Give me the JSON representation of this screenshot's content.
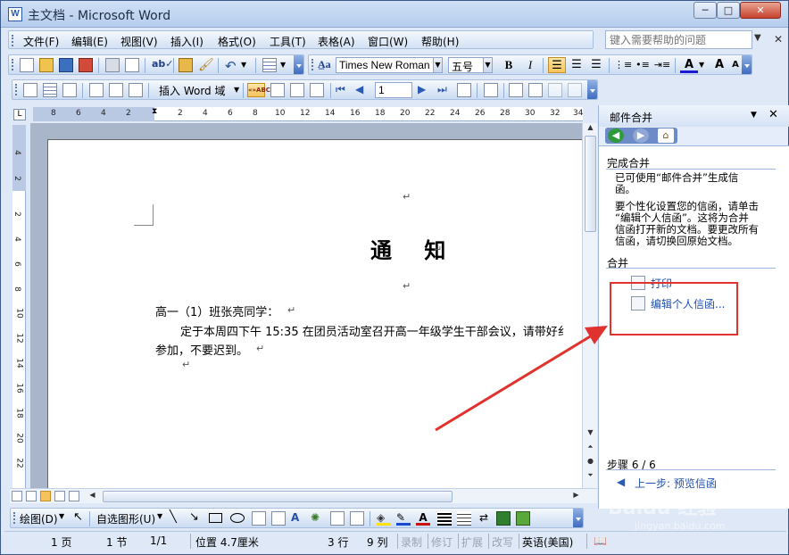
{
  "window": {
    "title": "主文档 - Microsoft Word"
  },
  "menu": {
    "items": [
      "文件(F)",
      "编辑(E)",
      "视图(V)",
      "插入(I)",
      "格式(O)",
      "工具(T)",
      "表格(A)",
      "窗口(W)",
      "帮助(H)"
    ],
    "help_placeholder": "键入需要帮助的问题"
  },
  "format_toolbar": {
    "font_name": "Times New Roman",
    "font_size": "五号",
    "bold": "B",
    "italic": "I",
    "font_color_label": "A",
    "grow_font": "A",
    "shrink_font": "A"
  },
  "mailmerge_toolbar": {
    "insert_field": "插入 Word 域",
    "record_number": "1",
    "abc_label": "«»ABC"
  },
  "ruler": {
    "h_numbers": [
      "8",
      "6",
      "4",
      "2",
      "2",
      "4",
      "6",
      "8",
      "10",
      "12",
      "14",
      "16",
      "18",
      "20",
      "22",
      "24",
      "26",
      "28",
      "30",
      "32",
      "34"
    ],
    "v_numbers": [
      "4",
      "2",
      "2",
      "4",
      "6",
      "8",
      "10",
      "12",
      "14",
      "16",
      "18",
      "20",
      "22"
    ]
  },
  "document": {
    "title": "通 知",
    "greeting": "高一（1）班张亮同学：",
    "body_line1": "定于本周四下午 15:35 在团员活动室召开高一年级学生干部会议，请带好纟",
    "body_line2": "参加，不要迟到。",
    "para_mark": "↵"
  },
  "task_pane": {
    "title": "邮件合并",
    "section1_heading": "完成合并",
    "text1_lines": [
      "已可使用“邮件合并”生成信",
      "函。"
    ],
    "text2_lines": [
      "要个性化设置您的信函，请单击",
      "“编辑个人信函”。这将为合并",
      "信函打开新的文档。要更改所有",
      "信函，请切换回原始文档。"
    ],
    "section2_heading": "合并",
    "link_print": "打印",
    "link_edit": "编辑个人信函...",
    "step_label": "步骤 6 / 6",
    "link_prev": "上一步: 预览信函"
  },
  "draw_toolbar": {
    "draw_label": "绘图(D)",
    "autoshapes_label": "自选图形(U)"
  },
  "status_bar": {
    "page": "1 页",
    "section": "1 节",
    "page_of": "1/1",
    "position": "位置 4.7厘米",
    "line": "3 行",
    "column": "9 列",
    "rec": "录制",
    "trk": "修订",
    "ext": "扩展",
    "ovr": "改写",
    "language": "英语(美国)"
  },
  "watermark": {
    "text": "Baidu 经验",
    "sub": "jingyan.baidu.com"
  },
  "colors": {
    "highlight": "#e0332f",
    "arrow": "#e0332f",
    "link": "#1e4fae"
  }
}
